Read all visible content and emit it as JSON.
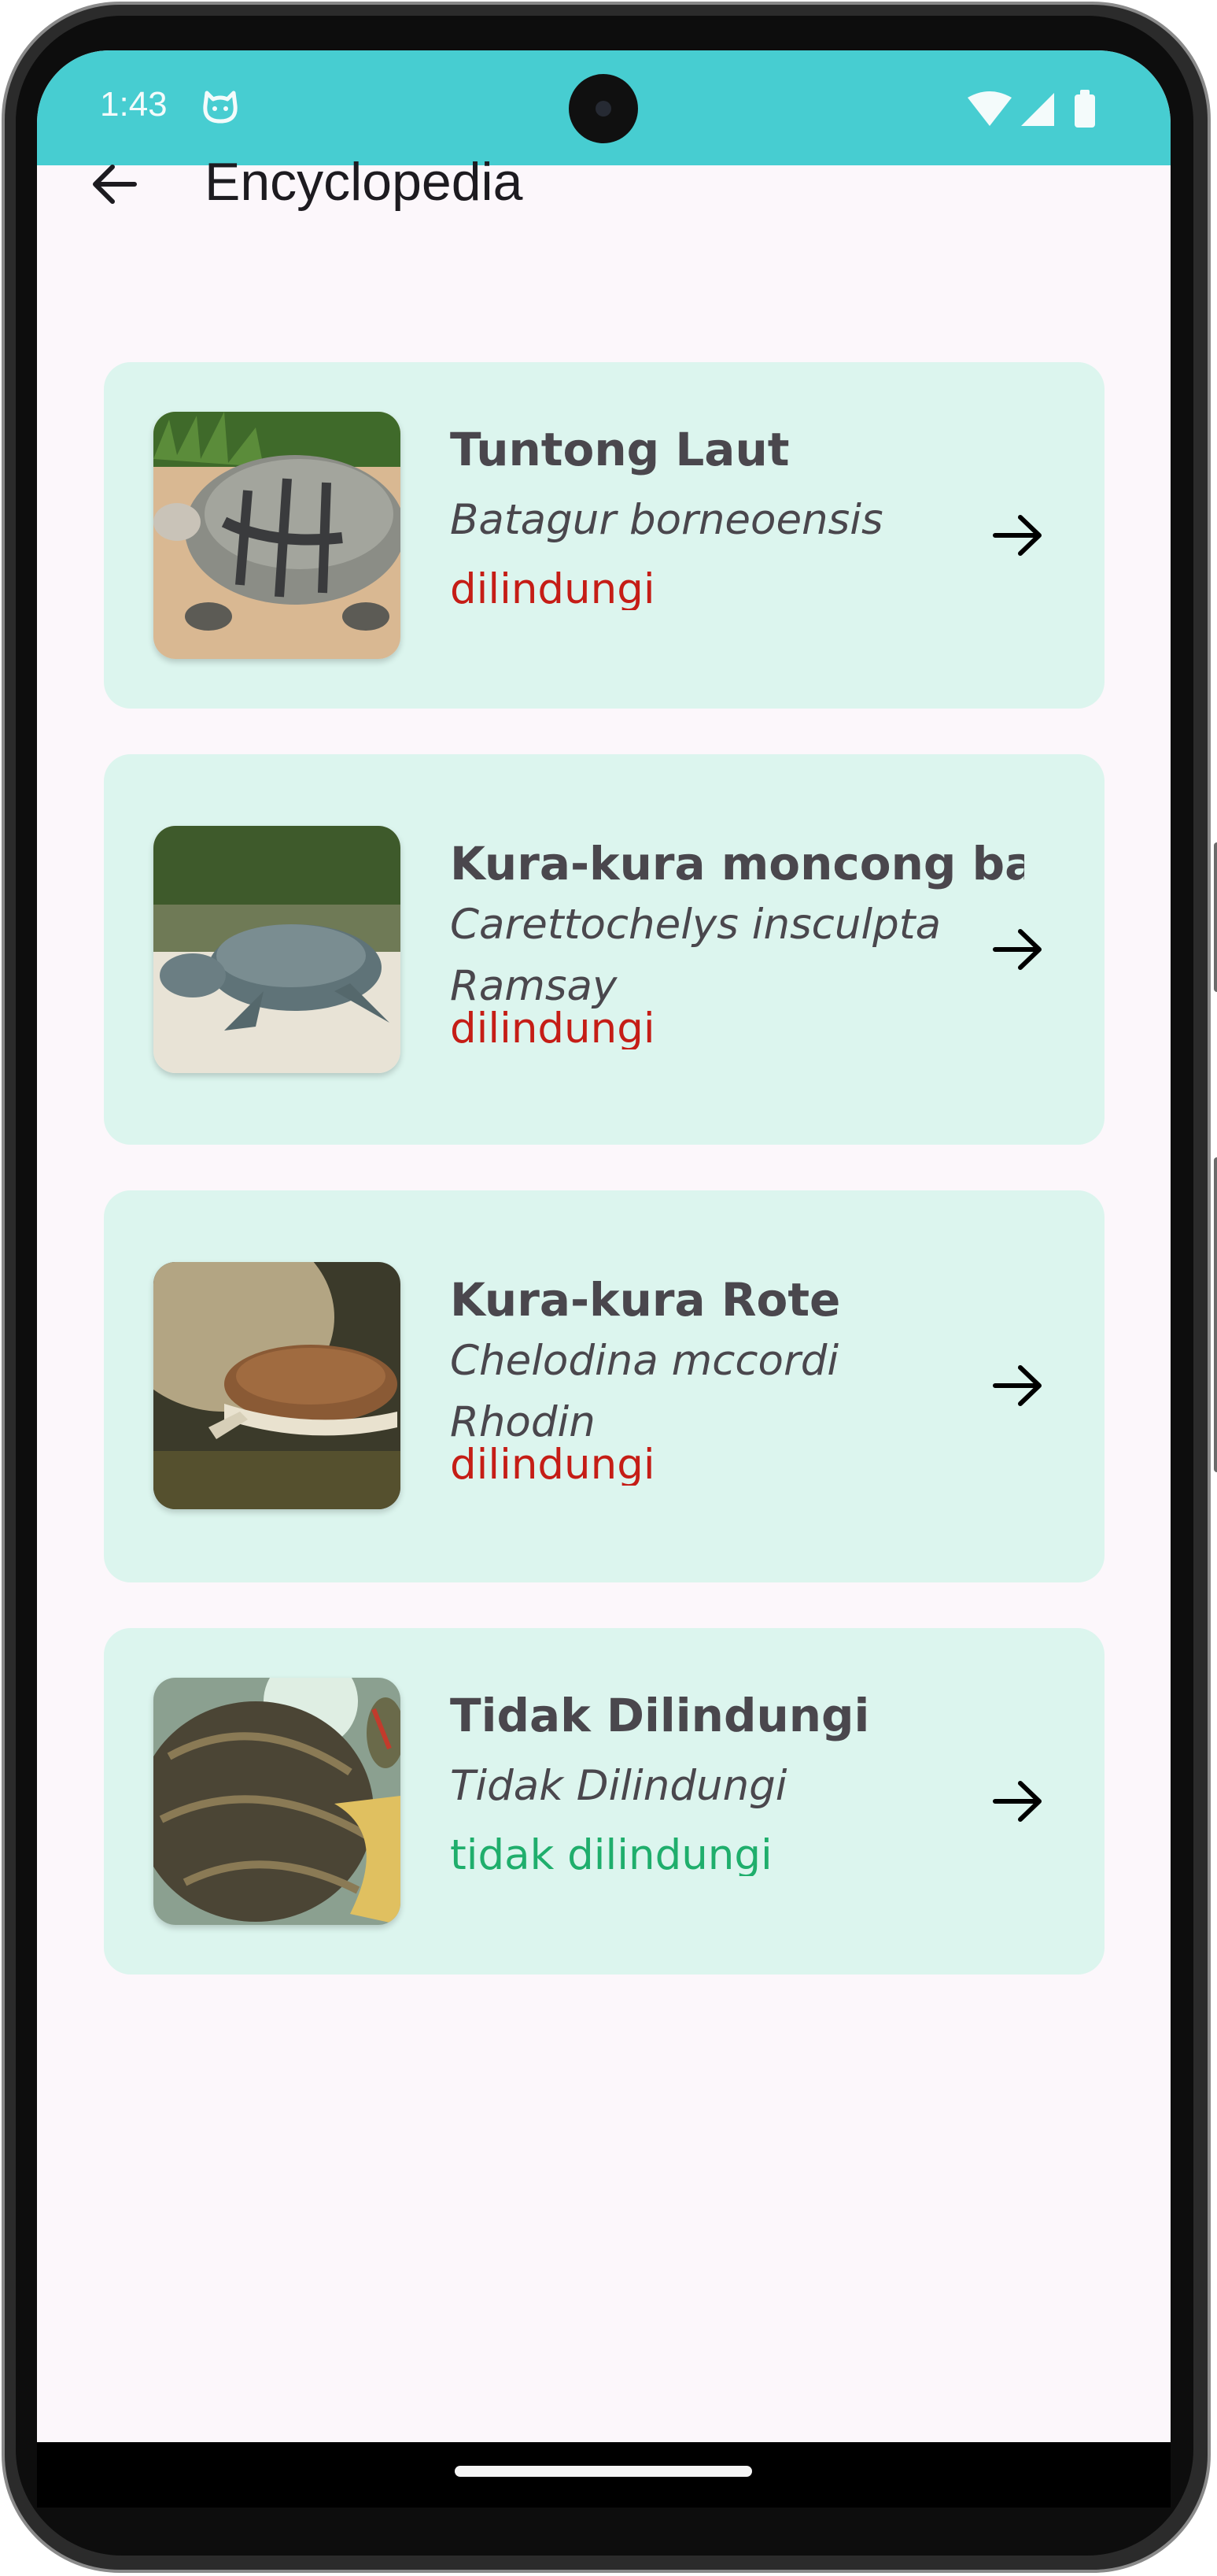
{
  "status_bar": {
    "time": "1:43",
    "background": "#47cdd1"
  },
  "app_bar": {
    "title": "Encyclopedia",
    "back_icon": "arrow-back-icon"
  },
  "colors": {
    "card_background": "#dcf5ee",
    "protected": "#c51d16",
    "unprotected": "#1fae6c",
    "text": "#4a474d"
  },
  "items": [
    {
      "name": "Tuntong Laut",
      "scientific_name": "Batagur borneoensis",
      "status": "dilindungi",
      "status_kind": "protected",
      "image": "tuntong-laut-photo"
    },
    {
      "name": "Kura-kura moncong babi",
      "scientific_name": "Carettochelys insculpta Ramsay",
      "status": "dilindungi",
      "status_kind": "protected",
      "image": "kura-kura-moncong-babi-photo"
    },
    {
      "name": "Kura-kura Rote",
      "scientific_name": "Chelodina mccordi Rhodin",
      "status": "dilindungi",
      "status_kind": "protected",
      "image": "kura-kura-rote-photo"
    },
    {
      "name": "Tidak Dilindungi",
      "scientific_name": "Tidak Dilindungi",
      "status": "tidak dilindungi",
      "status_kind": "unprotected",
      "image": "tidak-dilindungi-photo"
    }
  ]
}
